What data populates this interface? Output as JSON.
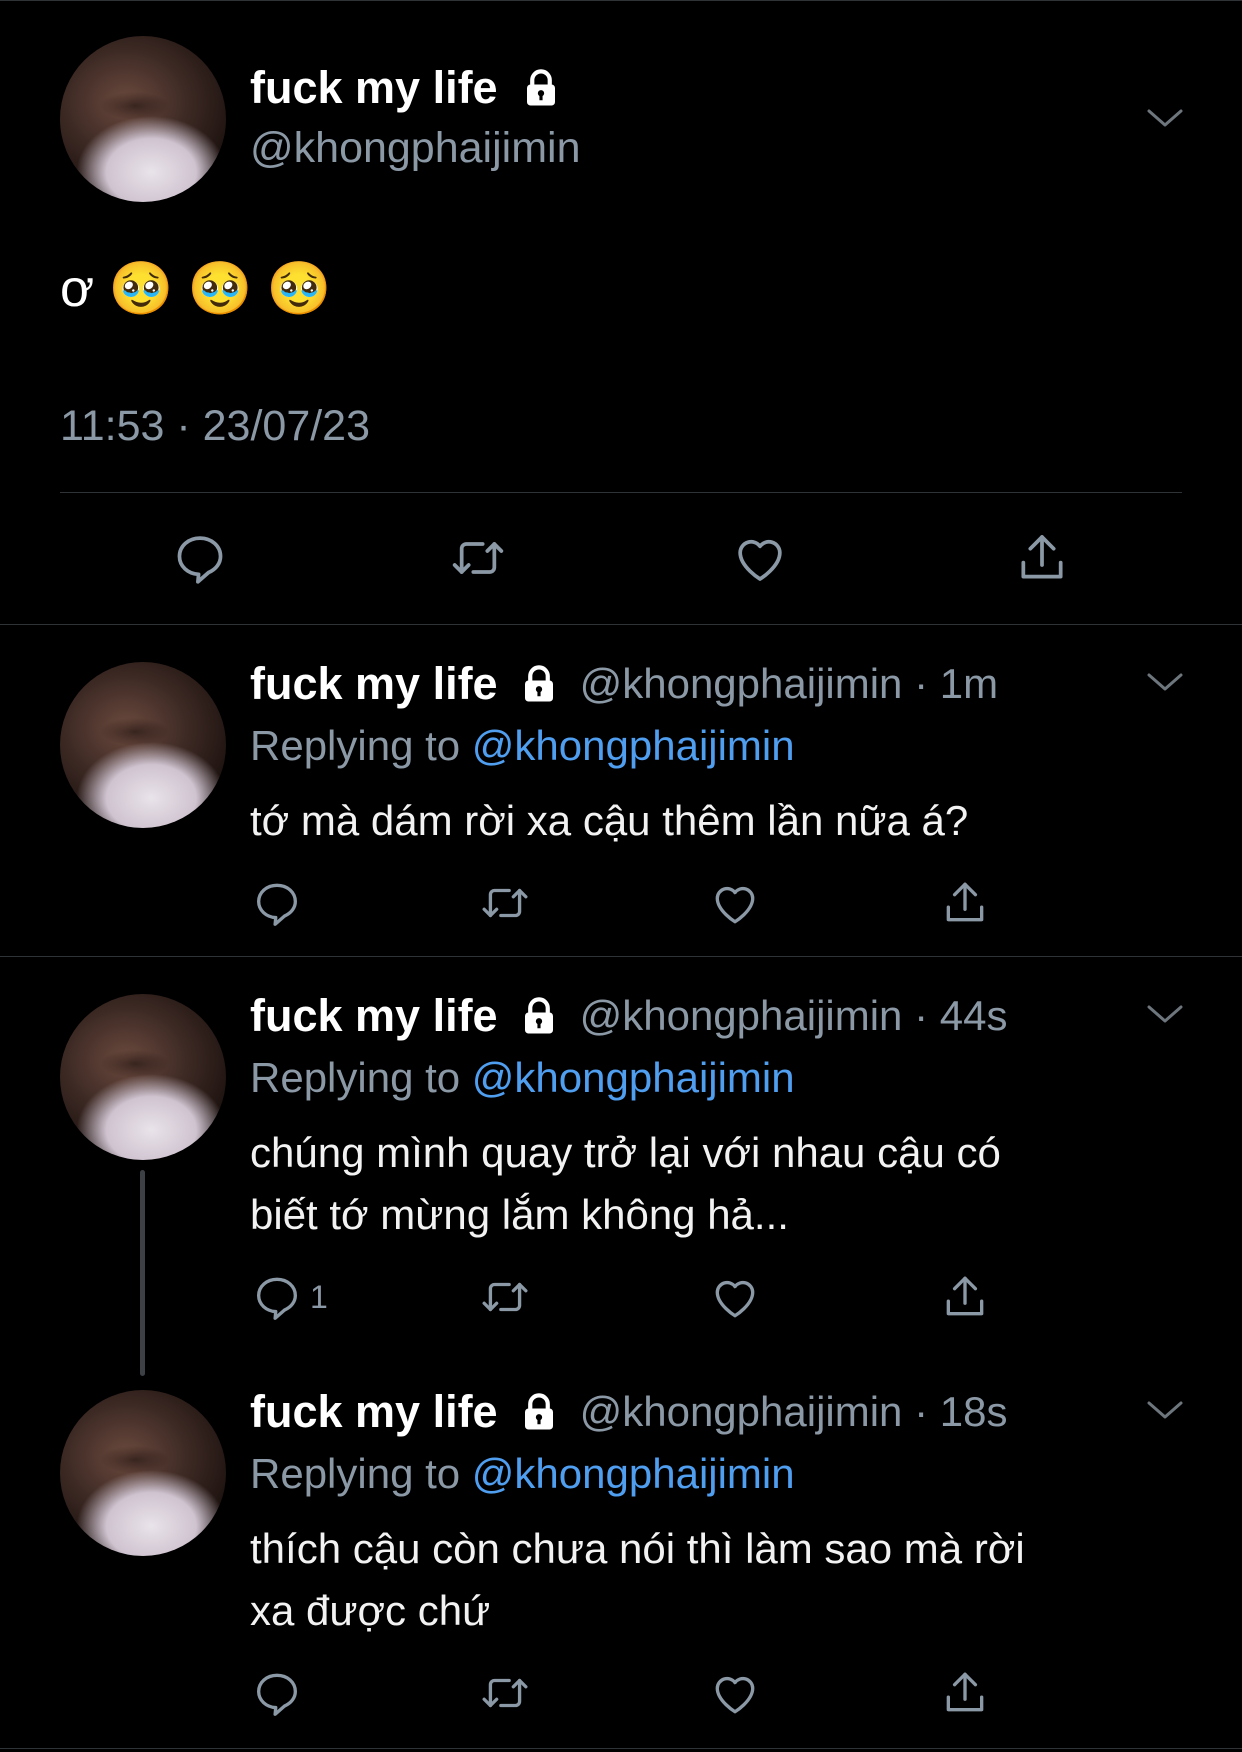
{
  "main_tweet": {
    "display_name": "fuck my life",
    "handle": "@khongphaijimin",
    "text": "ơ 🥹 🥹 🥹",
    "timestamp": "11:53 · 23/07/23"
  },
  "replies": [
    {
      "display_name": "fuck my life",
      "handle_time": "@khongphaijimin · 1m",
      "replying_prefix": "Replying to",
      "replying_handle": "@khongphaijimin",
      "text": "tớ mà dám rời xa cậu thêm lần nữa á?",
      "reply_count": ""
    },
    {
      "display_name": "fuck my life",
      "handle_time": "@khongphaijimin · 44s",
      "replying_prefix": "Replying to",
      "replying_handle": "@khongphaijimin",
      "text_line1": "chúng mình quay trở lại với nhau cậu có",
      "text_line2": "biết tớ mừng lắm không hả...",
      "reply_count": "1"
    },
    {
      "display_name": "fuck my life",
      "handle_time": "@khongphaijimin · 18s",
      "replying_prefix": "Replying to",
      "replying_handle": "@khongphaijimin",
      "text_line1": "thích cậu còn chưa nói thì làm sao mà rời",
      "text_line2": "xa được chứ",
      "reply_count": ""
    }
  ],
  "icons": [
    "lock-icon",
    "chevron-down-icon",
    "reply-icon",
    "retweet-icon",
    "like-icon",
    "share-icon"
  ],
  "colors": {
    "background": "#000000",
    "secondary_text": "#8b98a5",
    "link": "#4f9ef0",
    "divider": "#2f3336"
  }
}
